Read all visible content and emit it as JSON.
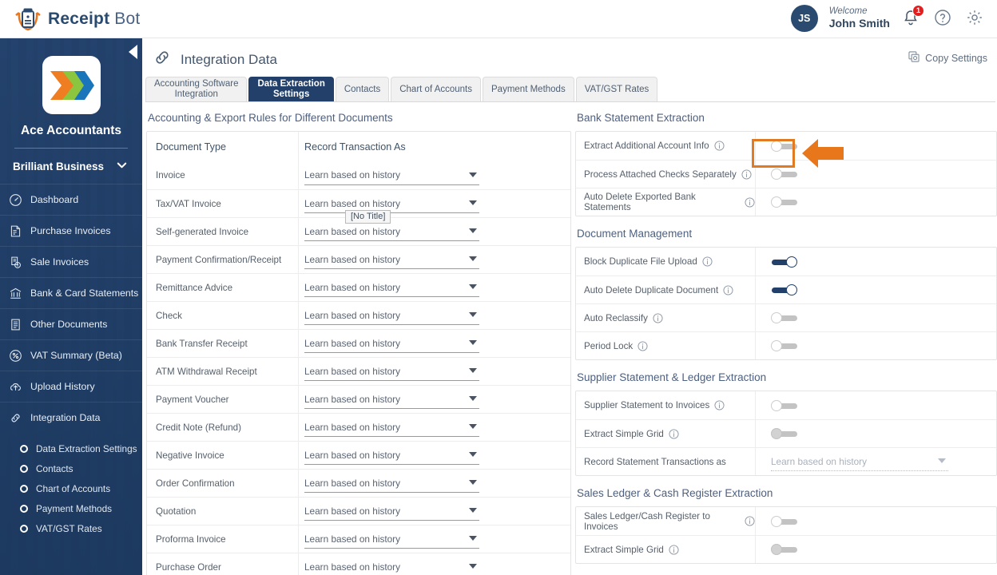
{
  "brand": {
    "name_bold": "Receipt",
    "name_light": " Bot",
    "logo_icon": "receipt-bot-logo"
  },
  "header": {
    "avatar_initials": "JS",
    "welcome_label": "Welcome",
    "user_name": "John Smith",
    "notification_count": "1",
    "bell_icon": "bell-icon",
    "help_icon": "help-circle-icon",
    "settings_icon": "gear-icon"
  },
  "sidebar": {
    "collapse_icon": "collapse-left-arrow-icon",
    "org_logo_icon": "ace-accountants-chevrons-logo",
    "org_name": "Ace Accountants",
    "company_selector": {
      "label": "Brilliant Business",
      "icon": "chevron-down-icon"
    },
    "items": [
      {
        "label": "Dashboard",
        "icon": "dashboard-gauge-icon"
      },
      {
        "label": "Purchase Invoices",
        "icon": "purchase-invoice-icon"
      },
      {
        "label": "Sale Invoices",
        "icon": "sale-invoice-icon"
      },
      {
        "label": "Bank & Card Statements",
        "icon": "bank-icon"
      },
      {
        "label": "Other Documents",
        "icon": "document-icon"
      },
      {
        "label": "VAT Summary (Beta)",
        "icon": "percent-circle-icon"
      },
      {
        "label": "Upload History",
        "icon": "upload-cloud-icon"
      },
      {
        "label": "Integration Data",
        "icon": "link-chain-icon"
      }
    ],
    "subitems": [
      {
        "label": "Data Extraction Settings",
        "icon": "ring-bullet-icon"
      },
      {
        "label": "Contacts",
        "icon": "ring-bullet-icon"
      },
      {
        "label": "Chart of Accounts",
        "icon": "ring-bullet-icon"
      },
      {
        "label": "Payment Methods",
        "icon": "ring-bullet-icon"
      },
      {
        "label": "VAT/GST Rates",
        "icon": "ring-bullet-icon"
      }
    ]
  },
  "page": {
    "title": "Integration Data",
    "title_icon": "link-chain-icon",
    "copy_settings": {
      "label": "Copy Settings",
      "icon": "copy-settings-icon"
    },
    "tabs": [
      {
        "label": "Accounting Software\nIntegration",
        "active": false
      },
      {
        "label": "Data Extraction\nSettings",
        "active": true
      },
      {
        "label": "Contacts",
        "active": false
      },
      {
        "label": "Chart of Accounts",
        "active": false
      },
      {
        "label": "Payment Methods",
        "active": false
      },
      {
        "label": "VAT/GST Rates",
        "active": false
      }
    ]
  },
  "left": {
    "section_title": "Accounting & Export Rules for Different Documents",
    "columns": {
      "doc_type": "Document Type",
      "record_as": "Record Transaction As"
    },
    "rows": [
      {
        "doc_type": "Invoice",
        "record_as": "Learn based on history"
      },
      {
        "doc_type": "Tax/VAT Invoice",
        "record_as": "Learn based on history"
      },
      {
        "doc_type": "Self-generated Invoice",
        "record_as": "Learn based on history"
      },
      {
        "doc_type": "Payment Confirmation/Receipt",
        "record_as": "Learn based on history"
      },
      {
        "doc_type": "Remittance Advice",
        "record_as": "Learn based on history"
      },
      {
        "doc_type": "Check",
        "record_as": "Learn based on history"
      },
      {
        "doc_type": "Bank Transfer Receipt",
        "record_as": "Learn based on history"
      },
      {
        "doc_type": "ATM Withdrawal Receipt",
        "record_as": "Learn based on history"
      },
      {
        "doc_type": "Payment Voucher",
        "record_as": "Learn based on history"
      },
      {
        "doc_type": "Credit Note (Refund)",
        "record_as": "Learn based on history"
      },
      {
        "doc_type": "Negative Invoice",
        "record_as": "Learn based on history"
      },
      {
        "doc_type": "Order Confirmation",
        "record_as": "Learn based on history"
      },
      {
        "doc_type": "Quotation",
        "record_as": "Learn based on history"
      },
      {
        "doc_type": "Proforma Invoice",
        "record_as": "Learn based on history"
      },
      {
        "doc_type": "Purchase Order",
        "record_as": "Learn based on history"
      }
    ]
  },
  "right": {
    "sections": [
      {
        "title": "Bank Statement Extraction",
        "rows": [
          {
            "label": "Extract Additional Account Info",
            "info_icon": "info-icon",
            "control": "toggle",
            "state": "off",
            "highlighted": true
          },
          {
            "label": "Process Attached Checks Separately",
            "info_icon": "info-icon",
            "control": "toggle",
            "state": "off"
          },
          {
            "label": "Auto Delete Exported Bank Statements",
            "info_icon": "info-icon",
            "control": "toggle",
            "state": "off"
          }
        ]
      },
      {
        "title": "Document Management",
        "rows": [
          {
            "label": "Block Duplicate File Upload",
            "info_icon": "info-icon",
            "control": "toggle",
            "state": "on"
          },
          {
            "label": "Auto Delete Duplicate Document",
            "info_icon": "info-icon",
            "control": "toggle",
            "state": "on"
          },
          {
            "label": "Auto Reclassify",
            "info_icon": "info-icon",
            "control": "toggle",
            "state": "off"
          },
          {
            "label": "Period Lock",
            "info_icon": "info-icon",
            "control": "toggle",
            "state": "off"
          }
        ]
      },
      {
        "title": "Supplier Statement & Ledger Extraction",
        "rows": [
          {
            "label": "Supplier Statement to Invoices",
            "info_icon": "info-icon",
            "control": "toggle",
            "state": "off"
          },
          {
            "label": "Extract Simple Grid",
            "info_icon": "info-icon",
            "control": "toggle",
            "state": "off-disabled"
          },
          {
            "label": "Record Statement Transactions as",
            "control": "select",
            "value": "Learn based on history"
          }
        ]
      },
      {
        "title": "Sales Ledger & Cash Register Extraction",
        "rows": [
          {
            "label": "Sales Ledger/Cash Register to Invoices",
            "info_icon": "info-icon",
            "control": "toggle",
            "state": "off"
          },
          {
            "label": "Extract Simple Grid",
            "info_icon": "info-icon",
            "control": "toggle",
            "state": "off-disabled"
          }
        ]
      }
    ]
  },
  "annotations": {
    "highlight_color": "#e07a23",
    "arrow_icon": "left-pointing-arrow-annotation",
    "tooltip_text": "[No Title]"
  }
}
